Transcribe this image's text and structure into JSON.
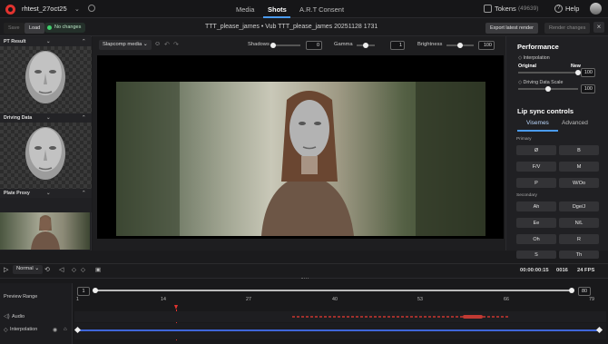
{
  "topbar": {
    "project": "rhtest_27oct25",
    "nav": [
      "Media",
      "Shots",
      "A.R.T Consent"
    ],
    "tokens_label": "Tokens",
    "tokens_count": "(49639)",
    "help_label": "Help"
  },
  "subbar": {
    "save": "Save",
    "load": "Load",
    "status": "No changes",
    "title": "TTT_please_james • Vub TTT_please_james 20251128 1731",
    "export": "Export latest render",
    "render": "Render changes"
  },
  "left_panel": {
    "sections": [
      "PT Result",
      "Driving Data",
      "Plate Proxy"
    ]
  },
  "viewer_toolbar": {
    "mode": "Slapcomp media",
    "shadows_label": "Shadows",
    "shadows_value": "0",
    "shadows_level": 0.0,
    "gamma_label": "Gamma",
    "gamma_value": "1",
    "gamma_level": 0.5,
    "brightness_label": "Brightness",
    "brightness_value": "100",
    "brightness_level": 0.5
  },
  "performance": {
    "title": "Performance",
    "interpolation_label": "Interpolation",
    "original_label": "Original",
    "new_label": "New",
    "interpolation_value": "100",
    "interpolation_level": 1.0,
    "driving_label": "Driving Data Scale",
    "driving_value": "100",
    "driving_level": 0.5
  },
  "lipsync": {
    "title": "Lip sync controls",
    "tabs": [
      "Visemes",
      "Advanced"
    ],
    "primary_label": "Primary",
    "primary": [
      "Ø",
      "B",
      "F/V",
      "M",
      "P",
      "W/Oo"
    ],
    "secondary_label": "Secondary",
    "secondary": [
      "Ah",
      "Dge/J",
      "Ee",
      "N/L",
      "Oh",
      "R",
      "S",
      "Th"
    ]
  },
  "transport": {
    "speed": "Normal",
    "timecode": "00:00:00:15",
    "frame": "0016",
    "fps": "24 FPS"
  },
  "timeline": {
    "preview_range_label": "Preview Range",
    "range_start": "1",
    "range_end": "80",
    "ticks": [
      "1",
      "14",
      "27",
      "40",
      "53",
      "66",
      "79"
    ],
    "tracks": [
      "Audio",
      "Interpolation"
    ]
  },
  "colors": {
    "accent": "#4a9bf0",
    "status_green": "#3fcf6b",
    "logo_red": "#e2332f",
    "playhead": "#e2332f"
  }
}
